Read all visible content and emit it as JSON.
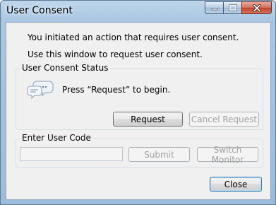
{
  "window": {
    "title": "User Consent"
  },
  "messages": {
    "line1": "You initiated an action that requires user consent.",
    "line2": "Use this window to request user consent."
  },
  "status_group": {
    "title": "User Consent Status",
    "icon": "speech-bubbles-icon",
    "status_text": "Press “Request” to begin.",
    "request_label": "Request",
    "cancel_label": "Cancel Request"
  },
  "code_group": {
    "title": "Enter User Code",
    "input_value": "",
    "submit_label": "Submit",
    "switch_label": "Switch Monitor"
  },
  "footer": {
    "close_label": "Close"
  }
}
